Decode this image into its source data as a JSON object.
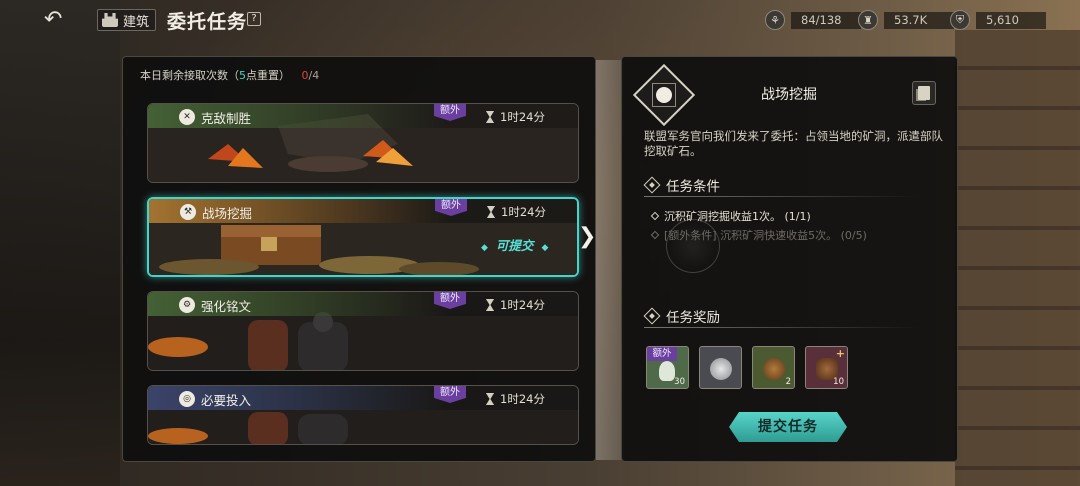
{
  "header": {
    "back_icon": "back-arrow-icon",
    "build_label": "建筑",
    "title": "委托任务",
    "help_label": "?",
    "resources": [
      {
        "icon": "wheat-icon",
        "glyph": "⚘",
        "value": "84/138"
      },
      {
        "icon": "tower-icon",
        "glyph": "♜",
        "value": "53.7K"
      },
      {
        "icon": "shield-icon",
        "glyph": "⛨",
        "value": "5,610"
      }
    ]
  },
  "left": {
    "daily_prefix": "本日剩余接取次数（",
    "daily_reset_num": "5",
    "daily_reset_text": "点重置）",
    "daily_used": "0",
    "daily_total": "/4",
    "cards": [
      {
        "name": "克敌制胜",
        "extra": "额外",
        "timer": "1时24分",
        "icon": "crossed-swords-icon"
      },
      {
        "name": "战场挖掘",
        "extra": "额外",
        "timer": "1时24分",
        "icon": "dig-icon",
        "status": "可提交"
      },
      {
        "name": "强化铭文",
        "extra": "额外",
        "timer": "1时24分",
        "icon": "rune-icon"
      },
      {
        "name": "必要投入",
        "extra": "额外",
        "timer": "1时24分",
        "icon": "invest-icon"
      }
    ]
  },
  "right": {
    "title": "战场挖掘",
    "description": "联盟军务官向我们发来了委托：占领当地的矿洞，派遣部队挖取矿石。",
    "conditions_title": "任务条件",
    "conditions": [
      {
        "text": "沉积矿洞挖掘收益1次。 (1/1)",
        "done": true
      },
      {
        "text": "[额外条件] 沉积矿洞快速收益5次。 (0/5)",
        "done": false
      }
    ],
    "rewards_title": "任务奖励",
    "rewards": [
      {
        "tag": "额外",
        "qty": "30",
        "icon": "feather-icon",
        "color": "#6f8a64"
      },
      {
        "tag": "",
        "qty": "",
        "icon": "silver-coins-icon",
        "color": "#5a5b60"
      },
      {
        "tag": "",
        "qty": "2",
        "icon": "pouch-icon",
        "color": "#5c6a3d"
      },
      {
        "tag": "",
        "qty": "10",
        "icon": "supply-bag-icon",
        "color": "#6a3b4a"
      }
    ],
    "submit_label": "提交任务"
  },
  "colors": {
    "accent": "#46d3c9",
    "extra_tag": "#6a3fa0",
    "daily_used": "#e0463a"
  }
}
